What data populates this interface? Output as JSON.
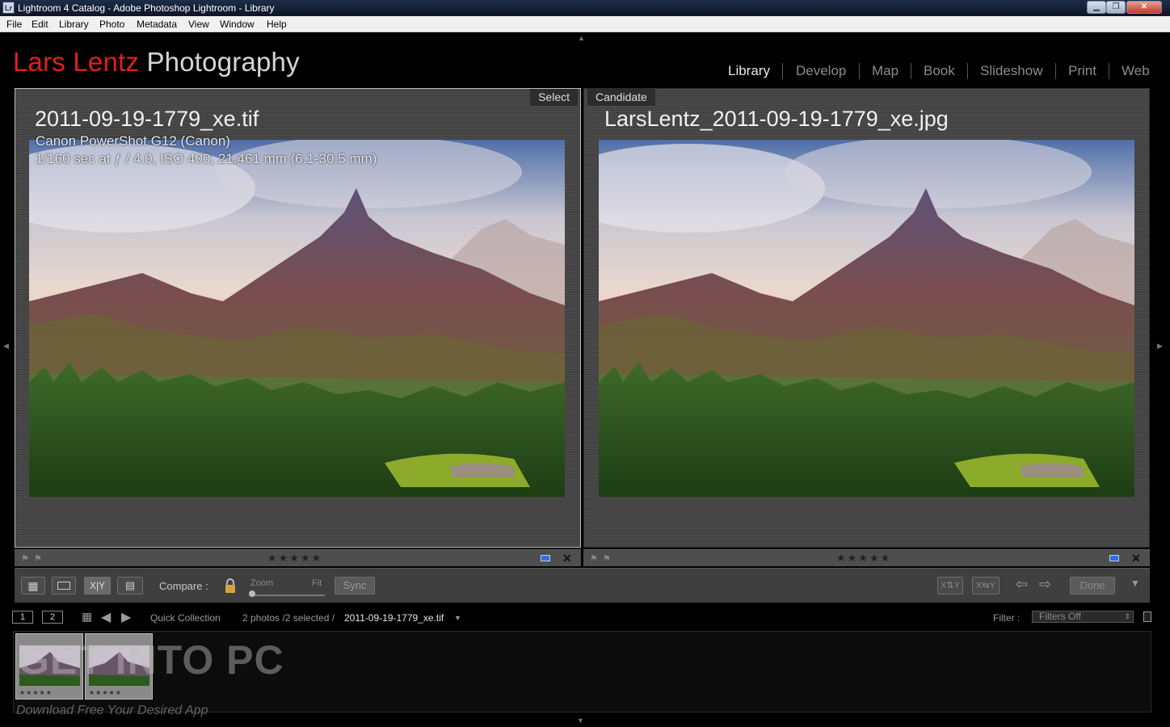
{
  "window": {
    "title": "Lightroom 4 Catalog - Adobe Photoshop Lightroom - Library",
    "app_icon": "Lr",
    "buttons": [
      "minimize-icon",
      "maximize-icon",
      "close-icon"
    ]
  },
  "menu": [
    "File",
    "Edit",
    "Library",
    "Photo",
    "Metadata",
    "View",
    "Window",
    "Help"
  ],
  "identity": {
    "first": "Lars Lentz",
    "second": "Photography"
  },
  "modules": [
    "Library",
    "Develop",
    "Map",
    "Book",
    "Slideshow",
    "Print",
    "Web"
  ],
  "active_module": "Library",
  "compare": {
    "select": {
      "tag": "Select",
      "filename": "2011-09-19-1779_xe.tif",
      "camera": "Canon PowerShot G12 (Canon)",
      "exposure": "1/160 sec at ƒ / 4.0, ISO 400, 21.461 mm (6.1-30.5 mm)",
      "stars": "★★★★★",
      "close": "✕"
    },
    "candidate": {
      "tag": "Candidate",
      "filename": "LarsLentz_2011-09-19-1779_xe.jpg",
      "stars": "★★★★★",
      "close": "✕"
    }
  },
  "toolbar": {
    "compare_label": "Compare :",
    "zoom_label": "Zoom",
    "fit_label": "Fit",
    "sync_label": "Sync",
    "done_label": "Done",
    "zoom_level": 0,
    "view_icons": [
      "grid-view-icon",
      "loupe-view-icon",
      "compare-view-icon",
      "survey-view-icon"
    ]
  },
  "filmstrip": {
    "pages": [
      "1",
      "2"
    ],
    "source": "Quick Collection",
    "count": "2 photos /2 selected /",
    "current_file": "2011-09-19-1779_xe.tif",
    "filter_label": "Filter :",
    "filter_value": "Filters Off",
    "thumb_stars": "★★★★★"
  },
  "watermark": {
    "text": "GET INTO PC",
    "sub": "Download Free Your Desired App"
  },
  "colors": {
    "accent_red": "#e0201c",
    "label_blue": "#2f6fe6",
    "active_module": "#e8e8e8"
  }
}
